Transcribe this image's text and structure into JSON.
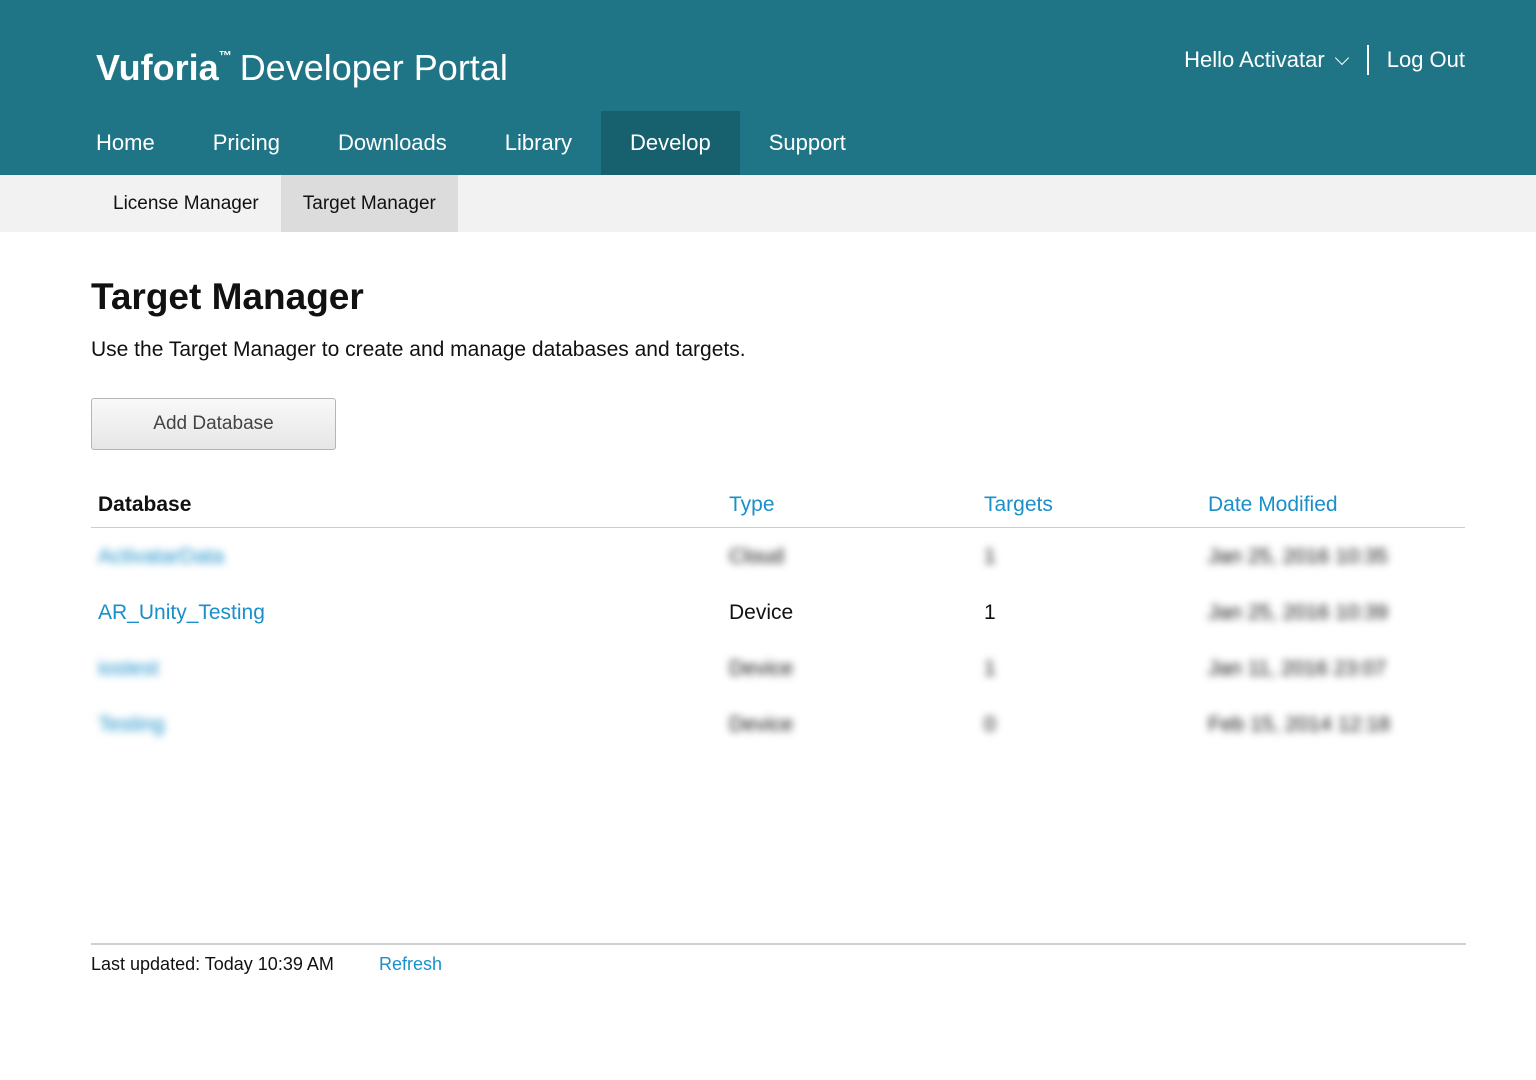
{
  "header": {
    "brand_strong": "Vuforia",
    "brand_tm": "™",
    "brand_rest": "Developer Portal",
    "user_greeting": "Hello Activatar",
    "logout_label": "Log Out",
    "background_color": "#1f7585",
    "active_nav_color": "#17606e"
  },
  "main_nav": {
    "items": [
      {
        "label": "Home"
      },
      {
        "label": "Pricing"
      },
      {
        "label": "Downloads"
      },
      {
        "label": "Library"
      },
      {
        "label": "Develop",
        "active": true
      },
      {
        "label": "Support"
      }
    ]
  },
  "sub_nav": {
    "items": [
      {
        "label": "License Manager"
      },
      {
        "label": "Target Manager",
        "active": true
      }
    ]
  },
  "page": {
    "title": "Target Manager",
    "subtitle": "Use the Target Manager to create and manage databases and targets.",
    "add_button_label": "Add Database"
  },
  "table": {
    "headers": {
      "database": "Database",
      "type": "Type",
      "targets": "Targets",
      "date_modified": "Date Modified"
    },
    "rows": [
      {
        "database": "ActivatarData",
        "type": "Cloud",
        "targets": "1",
        "date_modified": "Jan 25, 2016 10:35",
        "blurred": true
      },
      {
        "database": "AR_Unity_Testing",
        "type": "Device",
        "targets": "1",
        "date_modified": "Jan 25, 2016 10:39",
        "blurred_date": true
      },
      {
        "database": "iostest",
        "type": "Device",
        "targets": "1",
        "date_modified": "Jan 11, 2016 23:07",
        "blurred": true
      },
      {
        "database": "Testing",
        "type": "Device",
        "targets": "0",
        "date_modified": "Feb 15, 2014 12:18",
        "blurred": true
      }
    ],
    "link_color": "#1a8fc9"
  },
  "footer": {
    "last_updated": "Last updated: Today 10:39 AM",
    "refresh_label": "Refresh"
  }
}
